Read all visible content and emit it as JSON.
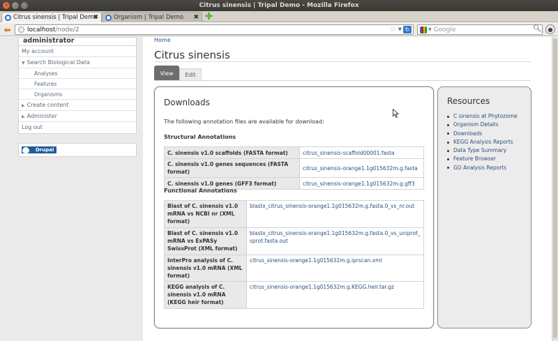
{
  "window": {
    "title": "Citrus sinensis | Tripal Demo - Mozilla Firefox"
  },
  "browser": {
    "tabs": [
      {
        "label": "Citrus sinensis | Tripal Demo",
        "active": true
      },
      {
        "label": "Organism | Tripal Demo",
        "active": false
      }
    ],
    "url_host": "localhost",
    "url_path": "/node/2",
    "search_placeholder": "Google"
  },
  "sidebar": {
    "user_block_title": "administrator",
    "items": [
      {
        "label": "My account",
        "level": 0
      },
      {
        "label": "Search Biological Data",
        "level": 0,
        "expanded": true
      },
      {
        "label": "Analyses",
        "level": 1
      },
      {
        "label": "Features",
        "level": 1
      },
      {
        "label": "Organisms",
        "level": 1
      },
      {
        "label": "Create content",
        "level": 0,
        "collapsed": true
      },
      {
        "label": "Administer",
        "level": 0,
        "collapsed": true
      },
      {
        "label": "Log out",
        "level": 0
      }
    ],
    "powered_by": "Drupal"
  },
  "page": {
    "breadcrumb": "Home",
    "title": "Citrus sinensis",
    "tabs": [
      {
        "label": "View",
        "active": true
      },
      {
        "label": "Edit",
        "active": false
      }
    ]
  },
  "downloads": {
    "title": "Downloads",
    "intro": "The following annotation files are available for download:",
    "structural_heading": "Structural Annotations",
    "structural": [
      {
        "label": "C. sinensis v1.0 scaffolds (FASTA format)",
        "file": "citrus_sinensis-scaffold00001.fasta"
      },
      {
        "label": "C. sinensis v1.0 genes sequences (FASTA format)",
        "file": "citrus_sinensis-orange1.1g015632m.g.fasta"
      },
      {
        "label": "C. sinensis v1.0 genes (GFF3 format)",
        "file": "citrus_sinensis-orange1.1g015632m.g.gff3"
      }
    ],
    "functional_heading": "Functional Annotations",
    "functional": [
      {
        "label": "Blast of C. sinensis v1.0 mRNA vs NCBI nr (XML format)",
        "file": "blastx_citrus_sinensis-orange1.1g015632m.g.fasta.0_vs_nr.out"
      },
      {
        "label": "Blast of C. sinensis v1.0 mRNA vs ExPASy SwissProt (XML format)",
        "file": "blastx_citrus_sinensis-orange1.1g015632m.g.fasta.0_vs_uniprot_sprot.fasta.out"
      },
      {
        "label": "InterPro analysis of C. sinensis v1.0 mRNA (XML format)",
        "file": "citrus_sinensis-orange1.1g015632m.g.iprscan.xml"
      },
      {
        "label": "KEGG analysis of C. sinensis v1.0 mRNA (KEGG heir format)",
        "file": "citrus_sinensis-orange1.1g015632m.g.KEGG.heir.tar.gz"
      }
    ]
  },
  "resources": {
    "title": "Resources",
    "items": [
      "C sinensis at Phytozome",
      "Organism Details",
      "Downloads",
      "KEGG Analysis Reports",
      "Data Type Summary",
      "Feature Browser",
      "GO Analysis Reports"
    ]
  },
  "colors": {
    "link": "#2c4e7a",
    "active_tab": "#6d6d6d",
    "sidebar_bg": "#eaeaea",
    "resources_bg": "#ececec"
  }
}
